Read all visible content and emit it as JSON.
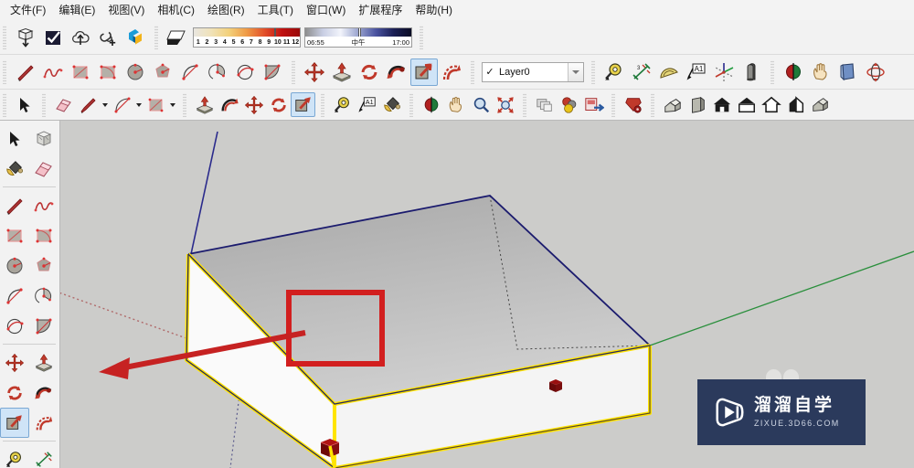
{
  "app": {
    "title": "SketchUp",
    "background_color": "#ccccca"
  },
  "menubar": {
    "items": [
      {
        "label": "文件(F)",
        "name": "menu-file"
      },
      {
        "label": "编辑(E)",
        "name": "menu-edit"
      },
      {
        "label": "视图(V)",
        "name": "menu-view"
      },
      {
        "label": "相机(C)",
        "name": "menu-camera"
      },
      {
        "label": "绘图(R)",
        "name": "menu-draw"
      },
      {
        "label": "工具(T)",
        "name": "menu-tools"
      },
      {
        "label": "窗口(W)",
        "name": "menu-window"
      },
      {
        "label": "扩展程序",
        "name": "menu-extensions"
      },
      {
        "label": "帮助(H)",
        "name": "menu-help"
      }
    ]
  },
  "toolbar_row1": {
    "warehouse": [
      {
        "icon": "cube-download-icon",
        "name": "get-models-button"
      },
      {
        "icon": "checkbox-icon",
        "name": "model-check-button"
      },
      {
        "icon": "cloud-upload-icon",
        "name": "share-model-button"
      },
      {
        "icon": "link-plus-icon",
        "name": "add-link-button"
      },
      {
        "icon": "3d-warehouse-logo-icon",
        "name": "warehouse-button"
      }
    ],
    "shadows": {
      "toggle": {
        "icon": "shadow-icon",
        "name": "shadow-toggle-button"
      },
      "month_slider": {
        "name": "shadow-month-slider",
        "ticks": [
          "1",
          "2",
          "3",
          "4",
          "5",
          "6",
          "7",
          "8",
          "9",
          "10",
          "11",
          "12"
        ],
        "value": 10
      },
      "time_slider": {
        "name": "shadow-time-slider",
        "start_label": "06:55",
        "mid_label": "中午",
        "end_label": "17:00"
      }
    }
  },
  "toolbar_row2": {
    "drawing": [
      {
        "icon": "line-icon",
        "name": "line-tool-button"
      },
      {
        "icon": "freehand-icon",
        "name": "freehand-tool-button"
      },
      {
        "icon": "rectangle-icon",
        "name": "rectangle-tool-button"
      },
      {
        "icon": "rotated-rectangle-icon",
        "name": "rotated-rectangle-tool-button"
      },
      {
        "icon": "circle-icon",
        "name": "circle-tool-button"
      },
      {
        "icon": "polygon-icon",
        "name": "polygon-tool-button"
      },
      {
        "icon": "arc-icon",
        "name": "arc-tool-button"
      },
      {
        "icon": "pie-icon",
        "name": "pie-tool-button"
      },
      {
        "icon": "two-point-arc-icon",
        "name": "two-point-arc-tool-button"
      },
      {
        "icon": "three-point-arc-icon",
        "name": "three-point-arc-tool-button"
      }
    ],
    "modify": [
      {
        "icon": "move-icon",
        "name": "move-tool-button",
        "active": false
      },
      {
        "icon": "push-pull-icon",
        "name": "push-pull-tool-button",
        "active": false
      },
      {
        "icon": "rotate-icon",
        "name": "rotate-tool-button",
        "active": false
      },
      {
        "icon": "follow-me-icon",
        "name": "follow-me-tool-button",
        "active": false
      },
      {
        "icon": "scale-icon",
        "name": "scale-tool-button",
        "active": true
      },
      {
        "icon": "offset-icon",
        "name": "offset-tool-button",
        "active": false
      }
    ],
    "layer": {
      "name": "layer-selector",
      "checked": true,
      "value": "Layer0"
    },
    "construction": [
      {
        "icon": "tape-measure-icon",
        "name": "tape-measure-tool-button"
      },
      {
        "icon": "dimension-icon",
        "name": "dimension-tool-button"
      },
      {
        "icon": "protractor-icon",
        "name": "protractor-tool-button"
      },
      {
        "icon": "text-label-icon",
        "name": "text-tool-button",
        "label": "A1"
      },
      {
        "icon": "axes-icon",
        "name": "axes-tool-button"
      },
      {
        "icon": "3d-text-icon",
        "name": "three-d-text-tool-button"
      }
    ],
    "camera": [
      {
        "icon": "section-plane-icon",
        "name": "section-plane-button"
      },
      {
        "icon": "pan-hand-icon",
        "name": "pan-tool-button"
      },
      {
        "icon": "page-icon",
        "name": "page-button"
      },
      {
        "icon": "orbit-icon",
        "name": "orbit-tool-button"
      }
    ]
  },
  "toolbar_row3": {
    "principal": [
      {
        "icon": "select-arrow-icon",
        "name": "select-tool-button"
      },
      {
        "icon": "eraser-icon",
        "name": "eraser-tool-button"
      },
      {
        "icon": "pencil-icon",
        "name": "pencil-tool-button",
        "has_caret": true
      },
      {
        "icon": "arc-icon",
        "name": "arc-tool-button-2",
        "has_caret": true
      },
      {
        "icon": "rectangle-icon",
        "name": "rectangle-tool-button-2",
        "has_caret": true
      }
    ],
    "edit": [
      {
        "icon": "push-pull-icon",
        "name": "push-pull-tool-button-2",
        "active": false
      },
      {
        "icon": "offset-icon",
        "name": "offset-tool-button-2",
        "active": false
      },
      {
        "icon": "move-icon",
        "name": "move-tool-button-2",
        "active": false
      },
      {
        "icon": "rotate-icon",
        "name": "rotate-tool-button-2",
        "active": false
      },
      {
        "icon": "scale-icon",
        "name": "scale-tool-button-2",
        "active": true
      }
    ],
    "measure": [
      {
        "icon": "tape-measure-icon",
        "name": "tape-measure-tool-button-2"
      },
      {
        "icon": "text-label-icon",
        "name": "text-tool-button-2",
        "label": "A1"
      },
      {
        "icon": "paint-bucket-icon",
        "name": "paint-bucket-tool-button"
      }
    ],
    "navigate": [
      {
        "icon": "section-plane-icon",
        "name": "section-plane-button-2"
      },
      {
        "icon": "pan-hand-icon",
        "name": "pan-tool-button-2"
      },
      {
        "icon": "zoom-magnifier-icon",
        "name": "zoom-tool-button"
      },
      {
        "icon": "zoom-extents-icon",
        "name": "zoom-extents-button"
      }
    ],
    "scenes": [
      {
        "icon": "scenes-icon",
        "name": "scenes-button"
      },
      {
        "icon": "styles-icon",
        "name": "styles-button"
      },
      {
        "icon": "export-image-icon",
        "name": "export-image-button"
      }
    ],
    "ruby": [
      {
        "icon": "ruby-gear-icon",
        "name": "ruby-console-button"
      }
    ],
    "views": [
      {
        "icon": "iso-view-icon",
        "name": "iso-view-button"
      },
      {
        "icon": "front-view-icon",
        "name": "front-view-button"
      },
      {
        "icon": "house-front-icon",
        "name": "house-front-view-button"
      },
      {
        "icon": "top-view-icon",
        "name": "top-view-button"
      },
      {
        "icon": "house-outline-icon",
        "name": "back-view-button"
      },
      {
        "icon": "right-view-icon",
        "name": "right-view-button"
      },
      {
        "icon": "layers-icon",
        "name": "layers-button"
      }
    ]
  },
  "left_toolbar": {
    "items": [
      {
        "icon": "select-arrow-icon",
        "name": "left-select-tool-button"
      },
      {
        "icon": "component-icon",
        "name": "left-component-tool-button"
      },
      {
        "icon": "paint-bucket-icon",
        "name": "left-paint-bucket-button"
      },
      {
        "icon": "eraser-icon",
        "name": "left-eraser-button"
      },
      {
        "icon": "line-icon",
        "name": "left-line-tool-button"
      },
      {
        "icon": "freehand-icon",
        "name": "left-freehand-tool-button"
      },
      {
        "icon": "rectangle-icon",
        "name": "left-rectangle-tool-button"
      },
      {
        "icon": "rotated-rectangle-icon",
        "name": "left-rotated-rectangle-button"
      },
      {
        "icon": "circle-icon",
        "name": "left-circle-tool-button"
      },
      {
        "icon": "polygon-icon",
        "name": "left-polygon-tool-button"
      },
      {
        "icon": "arc-icon",
        "name": "left-arc-tool-button"
      },
      {
        "icon": "pie-icon",
        "name": "left-pie-tool-button"
      },
      {
        "icon": "two-point-arc-icon",
        "name": "left-two-point-arc-button"
      },
      {
        "icon": "three-point-arc-icon",
        "name": "left-three-point-arc-button"
      },
      {
        "icon": "move-icon",
        "name": "left-move-tool-button"
      },
      {
        "icon": "push-pull-icon",
        "name": "left-push-pull-tool-button"
      },
      {
        "icon": "rotate-icon",
        "name": "left-rotate-tool-button"
      },
      {
        "icon": "follow-me-icon",
        "name": "left-follow-me-tool-button"
      },
      {
        "icon": "scale-icon",
        "name": "left-scale-tool-button"
      },
      {
        "icon": "offset-icon",
        "name": "left-offset-tool-button"
      },
      {
        "icon": "tape-measure-icon",
        "name": "left-tape-measure-button"
      },
      {
        "icon": "dimension-icon",
        "name": "left-dimension-button"
      }
    ],
    "active_index": 18
  },
  "viewport": {
    "name": "model-viewport",
    "axes": {
      "z_axis_color": "#2a2a8c",
      "y_axis_color": "#1f9b3d",
      "x_axis_color": "#c02020"
    },
    "selection": {
      "highlight_color": "#ffe400",
      "edge_color": "#1b1b6e"
    },
    "annotation": {
      "box_color": "#d21f1f",
      "arrow_color": "#c62222",
      "grip_color": "#8b0f0f"
    }
  },
  "watermark": {
    "name": "watermark",
    "title": "溜溜自学",
    "subtitle": "ZIXUE.3D66.COM",
    "background_color": "#2b3a5c"
  }
}
